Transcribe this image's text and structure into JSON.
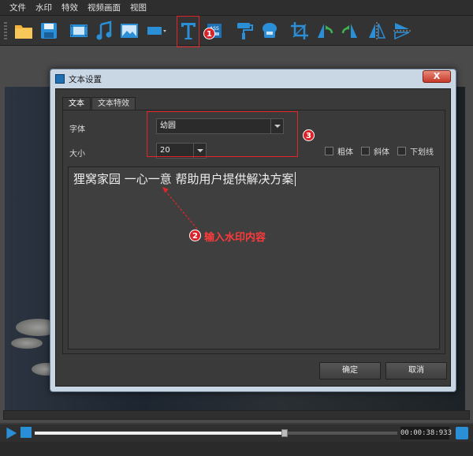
{
  "menu": [
    "文件",
    "水印",
    "特效",
    "视频画面",
    "视图"
  ],
  "toolbar": {
    "icons": [
      "folder-icon",
      "save-icon",
      "film-icon",
      "music-icon",
      "image-icon",
      "rectangle-icon",
      "text-icon",
      "ass-icon",
      "paint-roller-icon",
      "mosaic-icon",
      "crop-icon",
      "rotate-left-icon",
      "rotate-right-icon",
      "flip-horizontal-icon",
      "flip-vertical-icon"
    ],
    "ass_label": "ASS"
  },
  "dialog": {
    "title": "文本设置",
    "close_label": "X",
    "tabs": [
      "文本",
      "文本特效"
    ],
    "font_label": "字体",
    "font_value": "幼圆",
    "size_label": "大小",
    "size_value": "20",
    "bold_label": "粗体",
    "italic_label": "斜体",
    "underline_label": "下划线",
    "text_content": "狸窝家园  一心一意  帮助用户提供解决方案",
    "ok_label": "确定",
    "cancel_label": "取消"
  },
  "annotations": {
    "badge1": "1",
    "badge2": "2",
    "badge3": "3",
    "callout2": "输入水印内容",
    "color": "#e0262b"
  },
  "timeline": {
    "timecode": "00:00:38:933",
    "progress": 0.69
  },
  "colors": {
    "accent": "#2a8fd6",
    "dialog_frame": "#c9d6e4",
    "panel": "#3a3a3a"
  }
}
